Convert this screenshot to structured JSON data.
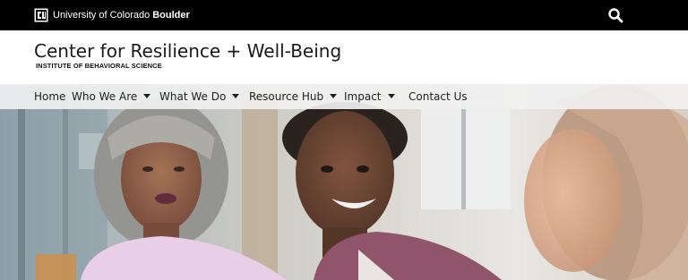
{
  "topbar": {
    "logo_icon": "cu-boulder-logo-icon",
    "university_name": "University of Colorado",
    "campus_name": "Boulder",
    "search_icon": "search-icon"
  },
  "header": {
    "title": "Center for Resilience + Well-Being",
    "subtitle": "INSTITUTE OF BEHAVIORAL SCIENCE"
  },
  "nav": {
    "items": [
      {
        "label": "Home",
        "has_dropdown": false
      },
      {
        "label": "Who We Are",
        "has_dropdown": true
      },
      {
        "label": "What We Do",
        "has_dropdown": true
      },
      {
        "label": "Resource Hub",
        "has_dropdown": true
      },
      {
        "label": "Impact",
        "has_dropdown": true
      },
      {
        "label": "Contact Us",
        "has_dropdown": false
      }
    ]
  },
  "colors": {
    "topbar_bg": "#000000",
    "nav_bg": "#f0f0f0",
    "brand_gold": "#cfb87c"
  }
}
